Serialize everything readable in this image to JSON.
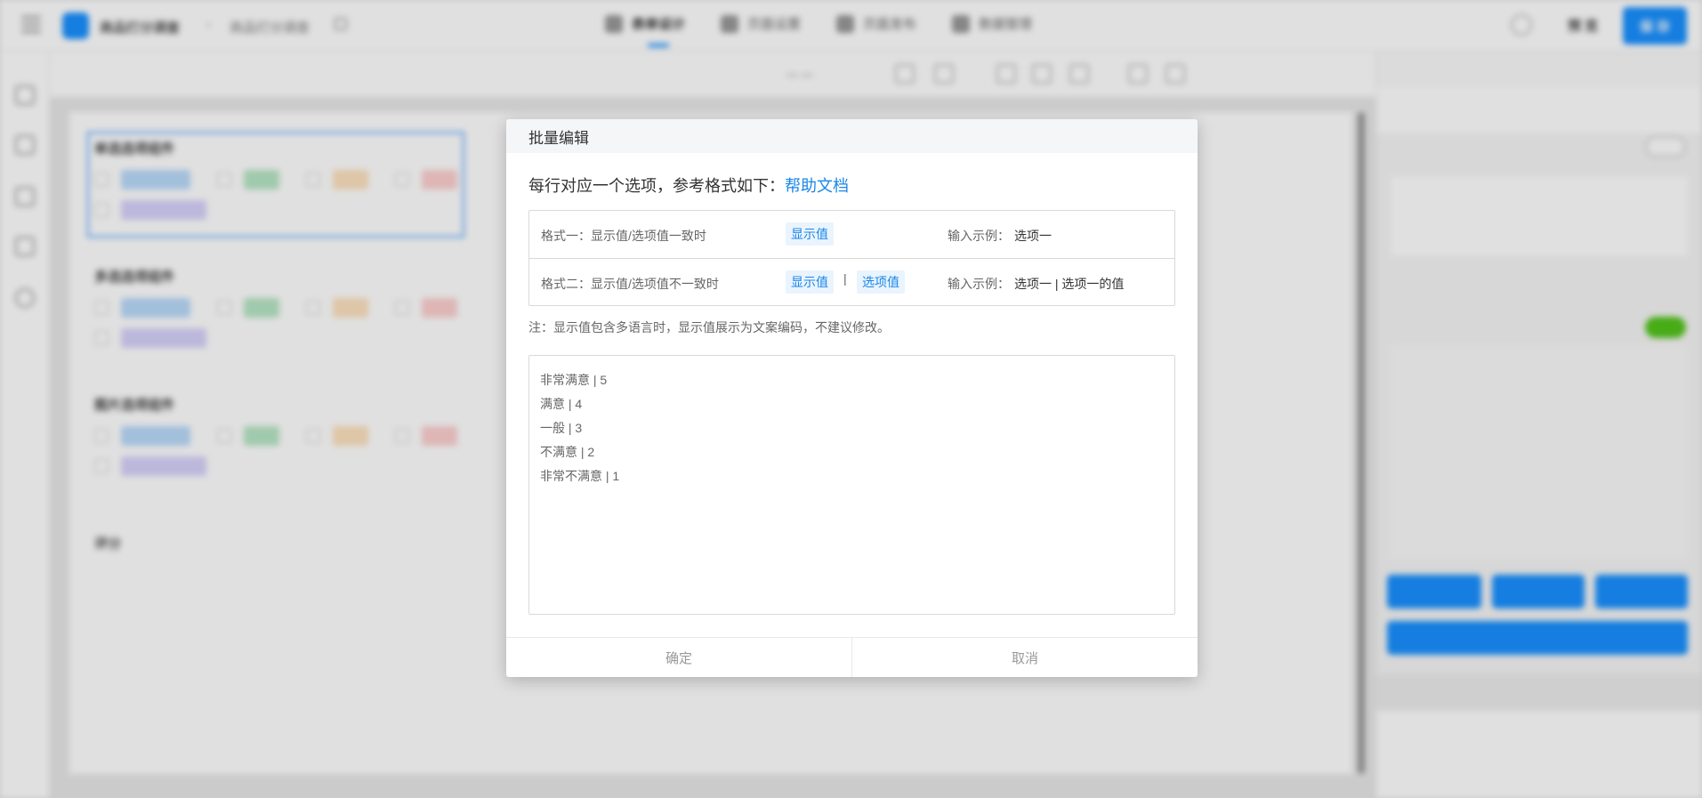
{
  "background": {
    "app_name": "商品打分调查",
    "page_name": "商品打分调查",
    "nav_tabs": [
      "表单设计",
      "页面设置",
      "页面发布",
      "数据管理"
    ],
    "preview_label": "预 览",
    "publish_label": "保 存",
    "field_groups": [
      "单选选项组件",
      "多选选项组件",
      "图片选项组件"
    ],
    "score_label": "评分"
  },
  "dialog": {
    "title": "批量编辑",
    "intro_text": "每行对应一个选项，参考格式如下：",
    "help_link": "帮助文档",
    "formats": [
      {
        "label": "格式一：显示值/选项值一致时",
        "tags": [
          "显示值"
        ],
        "example_label": "输入示例：",
        "example_value": "选项一"
      },
      {
        "label": "格式二：显示值/选项值不一致时",
        "tags": [
          "显示值",
          "选项值"
        ],
        "separator": "|",
        "example_label": "输入示例：",
        "example_value": "选项一 | 选项一的值"
      }
    ],
    "note": "注：显示值包含多语言时，显示值展示为文案编码，不建议修改。",
    "textarea_value": "非常满意 | 5\n满意 | 4\n一般 | 3\n不满意 | 2\n非常不满意 | 1",
    "confirm_label": "确定",
    "cancel_label": "取消"
  },
  "colors": {
    "accent": "#1a86e8",
    "tag_bg": "#eaf4fe",
    "primary": "#1890ff"
  }
}
